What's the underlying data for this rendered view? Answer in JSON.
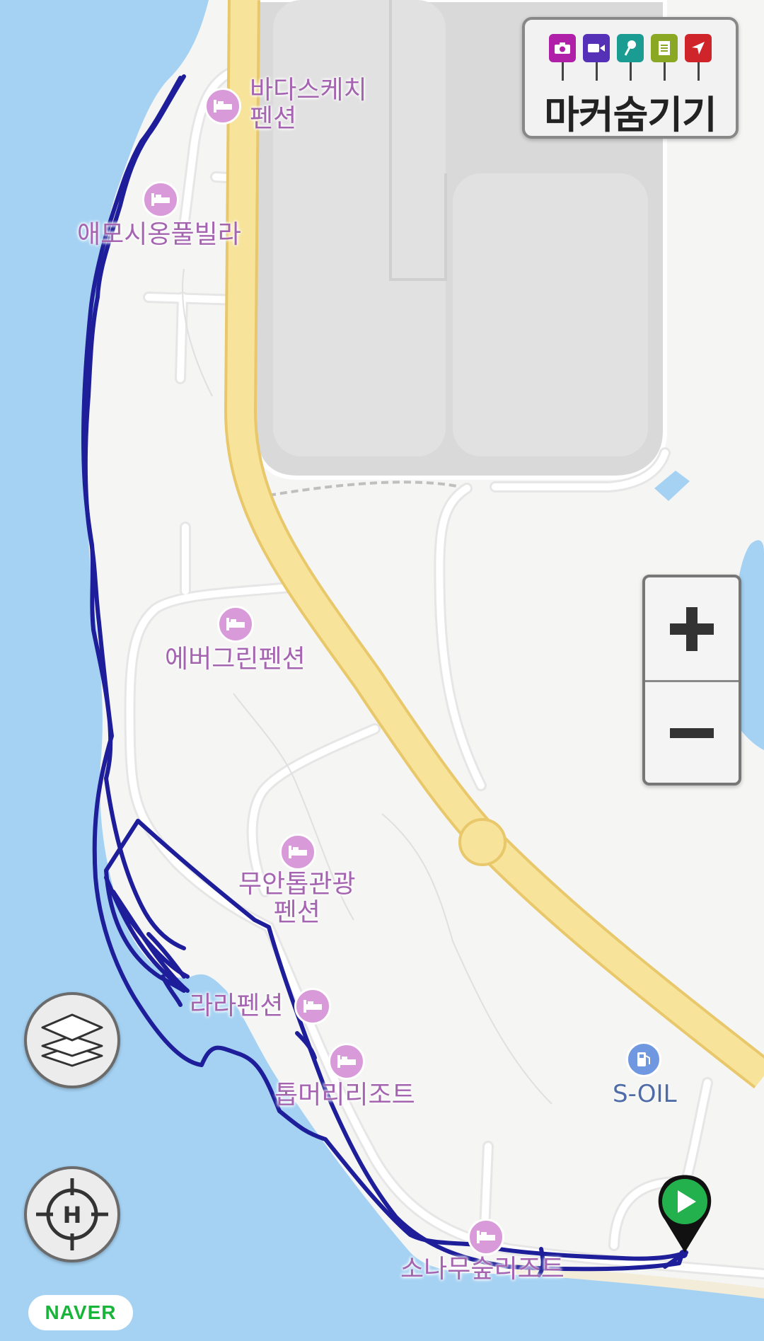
{
  "colors": {
    "water": "#a5d2f3",
    "land": "#f5f5f4",
    "highway": "#f7e39a",
    "highway_edge": "#e8c86a",
    "track": "#1e1e9a",
    "poi": "#a464b0",
    "poi_icon": "#d89ad8",
    "gas_label": "#4f6ca8",
    "gas_icon": "#6f98e0",
    "naver_green": "#19b53a",
    "start_pin": "#23b14d"
  },
  "marker_toolbar": {
    "label": "마커숨기기",
    "icons": [
      {
        "name": "camera-icon",
        "color": "#b01fa8"
      },
      {
        "name": "video-icon",
        "color": "#5531b8"
      },
      {
        "name": "microphone-icon",
        "color": "#1a9c93"
      },
      {
        "name": "note-icon",
        "color": "#8aa824"
      },
      {
        "name": "flag-icon",
        "color": "#d0242b"
      }
    ]
  },
  "pois": [
    {
      "label": "바다스케치\n펜션"
    },
    {
      "label": "애모시옹풀빌라"
    },
    {
      "label": "에버그린펜션"
    },
    {
      "label": "무안톱관광\n펜션"
    },
    {
      "label": "라라펜션"
    },
    {
      "label": "톱머리리조트"
    },
    {
      "label": "소나무숲리조트"
    }
  ],
  "gas_station": {
    "label": "S-OIL",
    "icon": "gas-pump-icon"
  },
  "controls": {
    "zoom_in_icon": "plus-icon",
    "zoom_out_icon": "minus-icon",
    "layers_icon": "layers-icon",
    "location_icon": "crosshair-h-icon",
    "start_icon": "play-icon"
  },
  "brand": {
    "logo": "NAVER"
  }
}
